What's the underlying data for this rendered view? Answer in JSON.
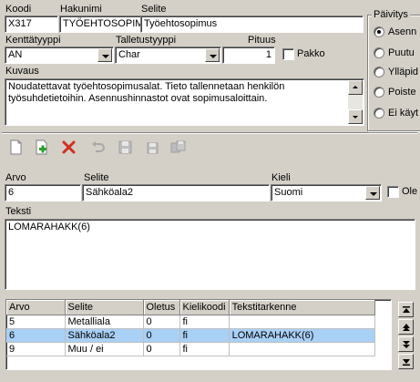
{
  "header": {
    "koodi_label": "Koodi",
    "koodi_value": "X317",
    "hakunimi_label": "Hakunimi",
    "hakunimi_value": "TYÖEHTOSOPIM",
    "selite_label": "Selite",
    "selite_value": "Työehtosopimus",
    "kenttatyyppi_label": "Kenttätyyppi",
    "kenttatyyppi_value": "AN",
    "talletustyyppi_label": "Talletustyyppi",
    "talletustyyppi_value": "Char",
    "pituus_label": "Pituus",
    "pituus_value": "1",
    "pakko_label": "Pakko",
    "kuvaus_label": "Kuvaus",
    "kuvaus_text": "Noudatettavat työehtosopimusalat. Tieto tallennetaan henkilön työsuhdetietoihin. Asennushinnastot ovat sopimusaloittain."
  },
  "paivitys": {
    "title": "Päivitys",
    "options": [
      "Asenn",
      "Puutu",
      "Ylläpid",
      "Poiste",
      "Ei käyt"
    ],
    "selected_index": 0
  },
  "toolbar": {
    "icons": [
      "page-icon",
      "add-icon",
      "delete-icon",
      "undo-icon",
      "save-icon",
      "save-single-icon",
      "save-all-icon"
    ]
  },
  "value_form": {
    "arvo_label": "Arvo",
    "arvo_value": "6",
    "selite_label": "Selite",
    "selite_value": "Sähköala2",
    "kieli_label": "Kieli",
    "kieli_value": "Suomi",
    "ole_label": "Ole",
    "teksti_label": "Teksti",
    "teksti_value": "LOMARAHAKK(6)"
  },
  "grid": {
    "columns": [
      "Arvo",
      "Selite",
      "Oletus",
      "Kielikoodi",
      "Tekstitarkenne"
    ],
    "rows": [
      [
        "5",
        "Metalliala",
        "0",
        "fi",
        ""
      ],
      [
        "6",
        "Sähköala2",
        "0",
        "fi",
        "LOMARAHAKK(6)"
      ],
      [
        "9",
        "Muu / ei",
        "0",
        "fi",
        ""
      ]
    ],
    "selected_row": 1
  }
}
